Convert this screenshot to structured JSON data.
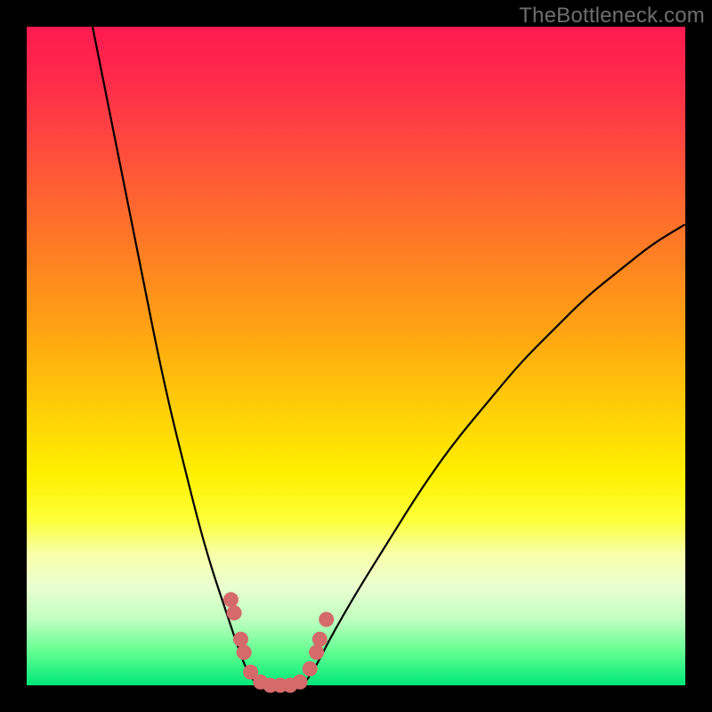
{
  "watermark": "TheBottleneck.com",
  "chart_data": {
    "type": "line",
    "title": "",
    "xlabel": "",
    "ylabel": "",
    "xlim": [
      0,
      100
    ],
    "ylim": [
      0,
      100
    ],
    "series": [
      {
        "name": "left-branch",
        "x": [
          10,
          12,
          14,
          16,
          18,
          20,
          22,
          24,
          26,
          28,
          30,
          32,
          33.5,
          35
        ],
        "values": [
          100,
          90,
          80,
          70,
          60,
          50,
          41,
          33,
          25,
          18,
          12,
          6,
          2,
          0
        ]
      },
      {
        "name": "right-branch",
        "x": [
          42,
          44,
          46,
          50,
          55,
          60,
          65,
          70,
          75,
          80,
          85,
          90,
          95,
          100
        ],
        "values": [
          0,
          3,
          7,
          14,
          22,
          30,
          37,
          43,
          49,
          54,
          59,
          63,
          67,
          70
        ]
      },
      {
        "name": "floor",
        "x": [
          35,
          36,
          37,
          38,
          39,
          40,
          41,
          42
        ],
        "values": [
          0,
          0,
          0,
          0,
          0,
          0,
          0,
          0
        ]
      }
    ],
    "markers": {
      "name": "salmon-dots",
      "color": "#d46a6a",
      "points": [
        {
          "x": 31.0,
          "y": 13.0
        },
        {
          "x": 31.5,
          "y": 11.0
        },
        {
          "x": 32.5,
          "y": 7.0
        },
        {
          "x": 33.0,
          "y": 5.0
        },
        {
          "x": 34.0,
          "y": 2.0
        },
        {
          "x": 35.5,
          "y": 0.5
        },
        {
          "x": 37.0,
          "y": 0.0
        },
        {
          "x": 38.5,
          "y": 0.0
        },
        {
          "x": 40.0,
          "y": 0.0
        },
        {
          "x": 41.5,
          "y": 0.5
        },
        {
          "x": 43.0,
          "y": 2.5
        },
        {
          "x": 44.0,
          "y": 5.0
        },
        {
          "x": 44.5,
          "y": 7.0
        },
        {
          "x": 45.5,
          "y": 10.0
        }
      ]
    },
    "background_gradient": {
      "top": "#ff1a50",
      "bottom": "#00e879"
    }
  }
}
